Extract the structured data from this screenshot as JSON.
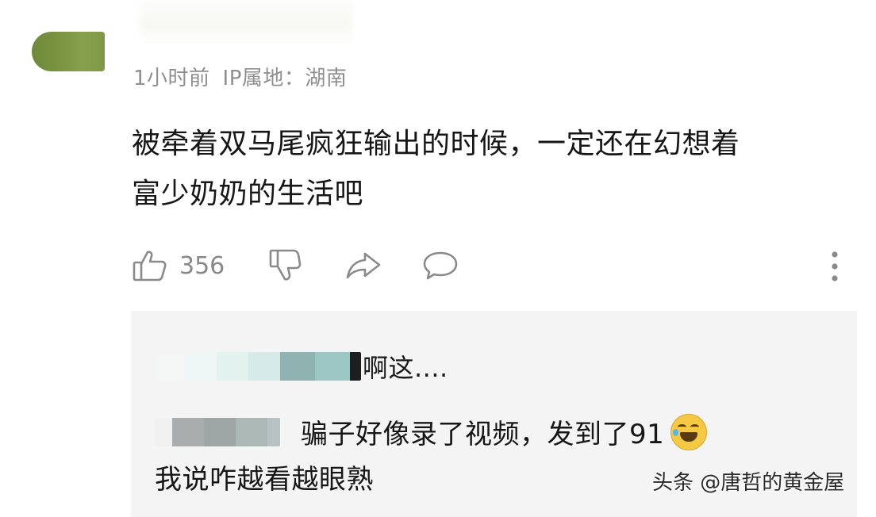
{
  "comment": {
    "meta": {
      "time": "1小时前",
      "ip_label": "IP属地：湖南"
    },
    "text_line1": "被牵着双马尾疯狂输出的时候，一定还在幻想着",
    "text_line2": "富少奶奶的生活吧",
    "actions": {
      "like_count": "356",
      "like_icon": "thumbs-up-icon",
      "dislike_icon": "thumbs-down-icon",
      "share_icon": "share-icon",
      "reply_icon": "comment-bubble-icon",
      "more_icon": "more-vertical-icon"
    }
  },
  "replies": [
    {
      "text": "啊这...."
    },
    {
      "text": "骗子好像录了视频，发到了91",
      "emoji": "laughing-crying-emoji"
    },
    {
      "text": "我说咋越看越眼熟"
    }
  ],
  "watermark": "头条 @唐哲的黄金屋",
  "colors": {
    "avatar": "#7b9442",
    "reply_bg": "#f4f4f4",
    "meta_text": "#8f8f8f"
  }
}
